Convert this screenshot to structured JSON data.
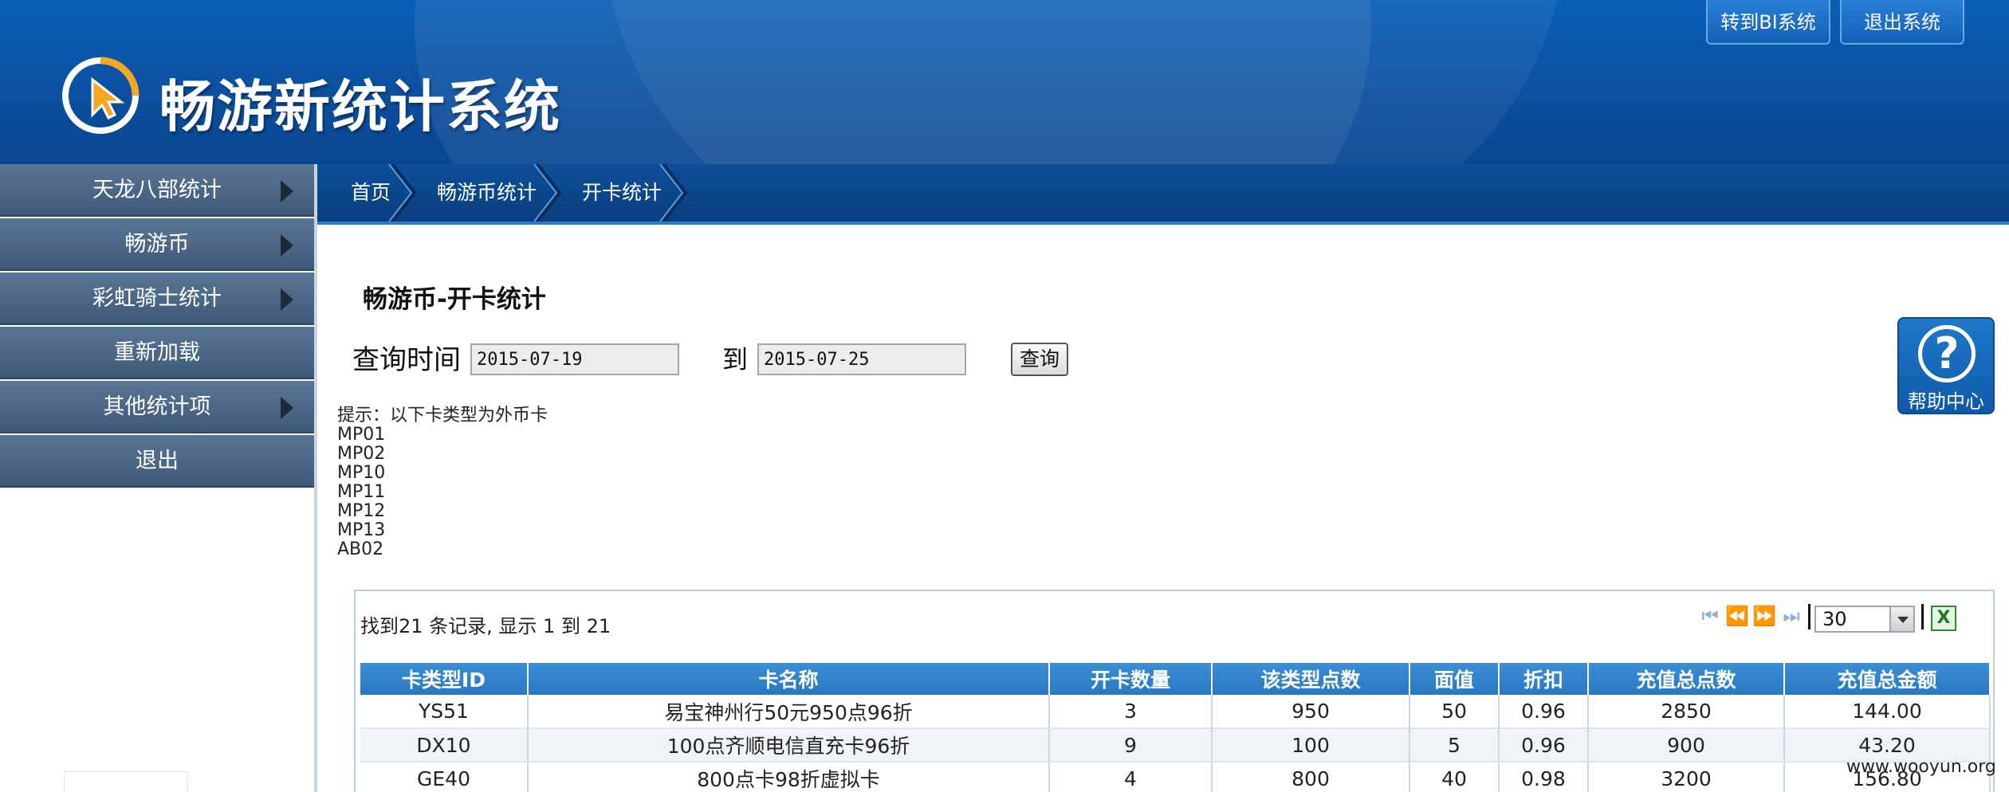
{
  "header": {
    "app_title": "畅游新统计系统",
    "buttons": {
      "to_bi": "转到BI系统",
      "logout": "退出系统"
    }
  },
  "sidebar": {
    "items": [
      {
        "label": "天龙八部统计",
        "has_submenu": true
      },
      {
        "label": "畅游币",
        "has_submenu": true
      },
      {
        "label": "彩虹骑士统计",
        "has_submenu": true
      },
      {
        "label": "重新加载",
        "has_submenu": false
      },
      {
        "label": "其他统计项",
        "has_submenu": true
      },
      {
        "label": "退出",
        "has_submenu": false
      }
    ]
  },
  "breadcrumb": {
    "items": [
      "首页",
      "畅游币统计",
      "开卡统计"
    ]
  },
  "page": {
    "title": "畅游币-开卡统计",
    "query": {
      "label": "查询时间",
      "from": "2015-07-19",
      "to_label": "到",
      "to": "2015-07-25",
      "button": "查询"
    },
    "hint": {
      "title": "提示：以下卡类型为外币卡",
      "codes": [
        "MP01",
        "MP02",
        "MP10",
        "MP11",
        "MP12",
        "MP13",
        "AB02"
      ]
    }
  },
  "help": {
    "label": "帮助中心",
    "icon": "question-icon"
  },
  "grid": {
    "summary": "找到21 条记录, 显示 1 到 21",
    "page_size": "30",
    "columns": [
      "卡类型ID",
      "卡名称",
      "开卡数量",
      "该类型点数",
      "面值",
      "折扣",
      "充值总点数",
      "充值总金额"
    ],
    "rows": [
      [
        "YS51",
        "易宝神州行50元950点96折",
        "3",
        "950",
        "50",
        "0.96",
        "2850",
        "144.00"
      ],
      [
        "DX10",
        "100点齐顺电信直充卡96折",
        "9",
        "100",
        "5",
        "0.96",
        "900",
        "43.20"
      ],
      [
        "GE40",
        "800点卡98折虚拟卡",
        "4",
        "800",
        "40",
        "0.98",
        "3200",
        "156.80"
      ]
    ]
  },
  "watermark": "www.wooyun.org",
  "colors": {
    "header_blue": "#0b4f9e",
    "sidebar": "#4b6785",
    "grid_header": "#2f82c9"
  }
}
